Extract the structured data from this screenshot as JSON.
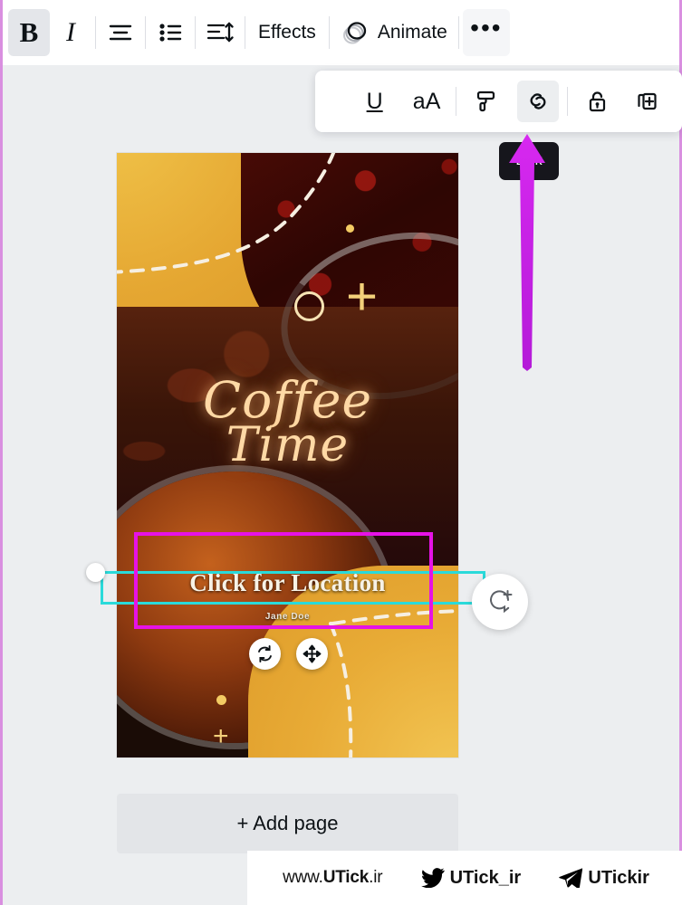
{
  "app": {
    "name": "Canva Editor",
    "canvas_bg": "#eceef0",
    "accent_selection": "#e612e6",
    "accent_handles": "#2adada",
    "annotation_arrow_color": "#c81fe8"
  },
  "toolbar": {
    "items": [
      {
        "name": "bold-button",
        "label": "B",
        "icon": "bold-icon",
        "active": true
      },
      {
        "name": "italic-button",
        "label": "I",
        "icon": "italic-icon",
        "active": false
      },
      {
        "name": "text-align-button",
        "label": "",
        "icon": "text-align-icon",
        "active": false
      },
      {
        "name": "bulleted-list-button",
        "label": "",
        "icon": "bulleted-list-icon",
        "active": false
      },
      {
        "name": "line-spacing-button",
        "label": "",
        "icon": "line-spacing-icon",
        "active": false
      },
      {
        "name": "effects-button",
        "label": "Effects",
        "icon": "",
        "active": false
      },
      {
        "name": "animate-button",
        "label": "Animate",
        "icon": "animate-icon",
        "active": false
      },
      {
        "name": "more-options-button",
        "label": "•••",
        "icon": "more-dots-icon",
        "active": false
      }
    ],
    "effects_label": "Effects",
    "animate_label": "Animate",
    "more_label": "•••",
    "bold_label": "B",
    "italic_label": "I"
  },
  "subbar": {
    "items": [
      {
        "name": "underline-button",
        "label": "U",
        "icon": "underline-icon",
        "active": false
      },
      {
        "name": "text-case-button",
        "label": "aA",
        "icon": "text-case-icon",
        "active": false
      },
      {
        "name": "copy-style-button",
        "label": "",
        "icon": "paint-roller-icon",
        "active": false
      },
      {
        "name": "link-button",
        "label": "",
        "icon": "link-icon",
        "active": true
      },
      {
        "name": "lock-button",
        "label": "",
        "icon": "lock-open-icon",
        "active": false
      },
      {
        "name": "duplicate-button",
        "label": "",
        "icon": "duplicate-icon",
        "active": false
      }
    ],
    "underline_label": "U",
    "text_case_label": "aA"
  },
  "tooltip": {
    "text": "Link"
  },
  "design": {
    "title_line1": "Coffee",
    "title_line2": "Time",
    "cta_text": "Click for Location",
    "byline": "Jane Doe",
    "palette": {
      "amber": "#e8ab36",
      "cream": "#ffd9a5",
      "dark": "#24090a",
      "grounds_red": "#4a0b06"
    }
  },
  "selection": {
    "rotate_handle_name": "rotate-handle",
    "move_handle_name": "move-handle",
    "comment_button_name": "add-comment-button"
  },
  "footer": {
    "add_page_label": "+ Add page"
  },
  "watermark": {
    "site_prefix": "www.",
    "site_brand": "UTick",
    "site_suffix": ".ir",
    "twitter_handle": "UTick_ir",
    "telegram_handle": "UTickir"
  }
}
